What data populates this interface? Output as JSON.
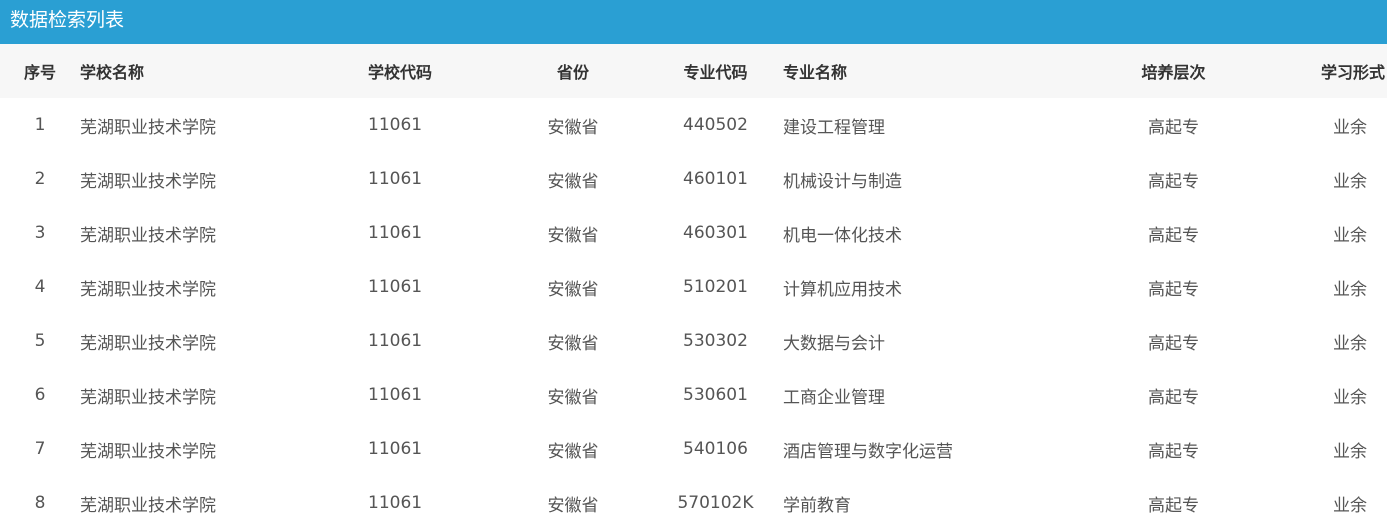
{
  "panel": {
    "title": "数据检索列表"
  },
  "table": {
    "headers": {
      "index": "序号",
      "school_name": "学校名称",
      "school_code": "学校代码",
      "province": "省份",
      "major_code": "专业代码",
      "major_name": "专业名称",
      "level": "培养层次",
      "study_form": "学习形式"
    },
    "rows": [
      {
        "index": "1",
        "school_name": "芜湖职业技术学院",
        "school_code": "11061",
        "province": "安徽省",
        "major_code": "440502",
        "major_name": "建设工程管理",
        "level": "高起专",
        "study_form": "业余"
      },
      {
        "index": "2",
        "school_name": "芜湖职业技术学院",
        "school_code": "11061",
        "province": "安徽省",
        "major_code": "460101",
        "major_name": "机械设计与制造",
        "level": "高起专",
        "study_form": "业余"
      },
      {
        "index": "3",
        "school_name": "芜湖职业技术学院",
        "school_code": "11061",
        "province": "安徽省",
        "major_code": "460301",
        "major_name": "机电一体化技术",
        "level": "高起专",
        "study_form": "业余"
      },
      {
        "index": "4",
        "school_name": "芜湖职业技术学院",
        "school_code": "11061",
        "province": "安徽省",
        "major_code": "510201",
        "major_name": "计算机应用技术",
        "level": "高起专",
        "study_form": "业余"
      },
      {
        "index": "5",
        "school_name": "芜湖职业技术学院",
        "school_code": "11061",
        "province": "安徽省",
        "major_code": "530302",
        "major_name": "大数据与会计",
        "level": "高起专",
        "study_form": "业余"
      },
      {
        "index": "6",
        "school_name": "芜湖职业技术学院",
        "school_code": "11061",
        "province": "安徽省",
        "major_code": "530601",
        "major_name": "工商企业管理",
        "level": "高起专",
        "study_form": "业余"
      },
      {
        "index": "7",
        "school_name": "芜湖职业技术学院",
        "school_code": "11061",
        "province": "安徽省",
        "major_code": "540106",
        "major_name": "酒店管理与数字化运营",
        "level": "高起专",
        "study_form": "业余"
      },
      {
        "index": "8",
        "school_name": "芜湖职业技术学院",
        "school_code": "11061",
        "province": "安徽省",
        "major_code": "570102K",
        "major_name": "学前教育",
        "level": "高起专",
        "study_form": "业余"
      }
    ]
  }
}
